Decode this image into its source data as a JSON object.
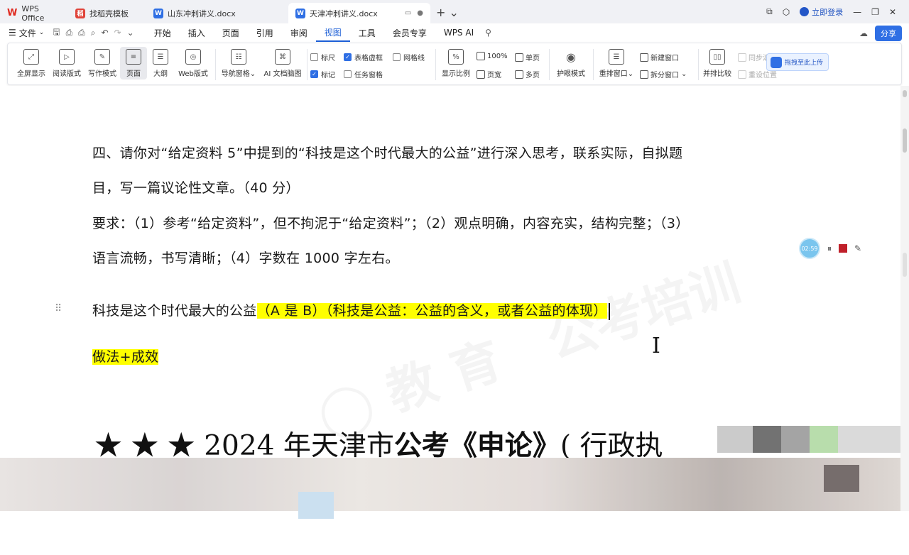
{
  "tabs": [
    {
      "label": "WPS Office",
      "icon": "wps-logo-icon"
    },
    {
      "label": "找稻壳模板",
      "icon": "docer-icon",
      "color": "#e0443a"
    },
    {
      "label": "山东冲刺讲义.docx",
      "icon": "word-doc-icon",
      "color": "#2f6fe4"
    },
    {
      "label": "天津冲刺讲义.docx",
      "icon": "word-doc-icon",
      "color": "#2f6fe4"
    }
  ],
  "window": {
    "login": "立即登录",
    "share": "分享"
  },
  "menu": {
    "file": "文件",
    "items": [
      "开始",
      "插入",
      "页面",
      "引用",
      "审阅",
      "视图",
      "工具",
      "会员专享",
      "WPS AI"
    ],
    "active": "视图"
  },
  "ribbon": {
    "buttons": [
      "全屏显示",
      "阅读版式",
      "写作模式",
      "页面",
      "大纲",
      "Web版式",
      "导航窗格",
      "AI 文档脑图",
      "显示比例",
      "护眼模式",
      "重排窗口",
      "拆分窗口",
      "并排比较"
    ],
    "checks": [
      {
        "label": "标尺",
        "on": false
      },
      {
        "label": "表格虚框",
        "on": true
      },
      {
        "label": "网格线",
        "on": false
      },
      {
        "label": "标记",
        "on": true
      },
      {
        "label": "任务窗格",
        "on": false
      }
    ],
    "zoom": [
      "100%",
      "页宽",
      "单页",
      "多页"
    ],
    "window": [
      "新建窗口"
    ],
    "disabled": [
      "同步滚动",
      "重设位置"
    ],
    "upload": "拖拽至此上传"
  },
  "doc": {
    "q_line1": "四、请你对“给定资料 5”中提到的“科技是这个时代最大的公益”进行深入思考，联系实际，自拟题",
    "q_line2": "目，写一篇议论性文章。（40 分）",
    "req_line1": "要求：（1）参考“给定资料”，但不拘泥于“给定资料”；（2）观点明确，内容充实，结构完整；（3）",
    "req_line2": "语言流畅，书写清晰；（4）字数在 1000 字左右。",
    "title_plain": "科技是这个时代最大的公益",
    "title_note": "（A 是 B）（科技是公益：公益的含义，或者公益的体现）",
    "method": "做法+成效",
    "heading_pre": "★ ★ ★  2024 年天津市",
    "heading_bold": "公考《申论》",
    "heading_post": "( 行政执",
    "highlight_color": "#ffff00"
  },
  "recorder": {
    "time": "02:59"
  }
}
